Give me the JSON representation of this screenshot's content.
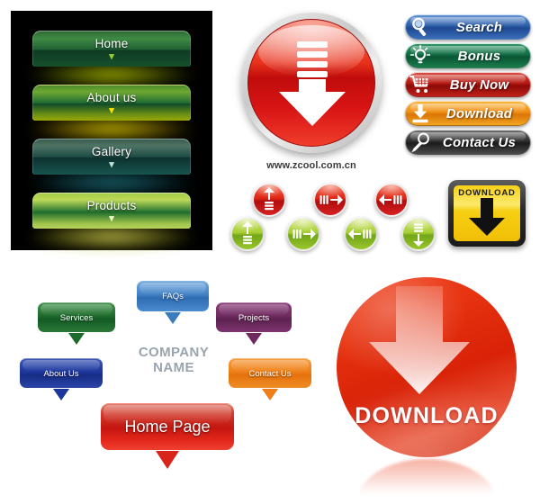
{
  "dark_nav": {
    "items": [
      {
        "label": "Home",
        "chevron": "chevron-down",
        "accent": "#c8d900"
      },
      {
        "label": "About us",
        "chevron": "chevron-down",
        "accent": "#f2e100"
      },
      {
        "label": "Gallery",
        "chevron": "chevron-down",
        "accent": "#1f7a86"
      },
      {
        "label": "Products",
        "chevron": "chevron-down",
        "accent": "#e8e45c"
      }
    ]
  },
  "red_circle_button": {
    "icon": "download-arrow-icon",
    "accent": "#d81414"
  },
  "watermark": {
    "url_text": "www.zcool.com.cn"
  },
  "arrow_buttons": {
    "red_row": [
      {
        "direction": "up",
        "icon": "arrow-up-icon",
        "color": "#d82121"
      },
      {
        "direction": "right",
        "icon": "arrow-right-icon",
        "color": "#d82121"
      },
      {
        "direction": "left",
        "icon": "arrow-left-icon",
        "color": "#d82121"
      }
    ],
    "green_row": [
      {
        "direction": "up",
        "icon": "arrow-up-icon",
        "color": "#9ac62b"
      },
      {
        "direction": "right",
        "icon": "arrow-right-icon",
        "color": "#9ac62b"
      },
      {
        "direction": "left",
        "icon": "arrow-left-icon",
        "color": "#9ac62b"
      },
      {
        "direction": "down",
        "icon": "arrow-down-icon",
        "color": "#9ac62b"
      }
    ]
  },
  "yellow_download_button": {
    "label": "DOWNLOAD",
    "icon": "arrow-down-icon",
    "accent": "#f6cf12"
  },
  "pill_buttons": [
    {
      "label": "Search",
      "icon": "magnifier-icon",
      "color": "#2c5da8"
    },
    {
      "label": "Bonus",
      "icon": "lightbulb-icon",
      "color": "#0f6b42"
    },
    {
      "label": "Buy Now",
      "icon": "shopping-cart-icon",
      "color": "#b4170f"
    },
    {
      "label": "Download",
      "icon": "download-tray-icon",
      "color": "#ef8c10"
    },
    {
      "label": "Contact Us",
      "icon": "pen-icon",
      "color": "#2f2f2f"
    }
  ],
  "bubble_nav": {
    "company_name_line1": "COMPANY",
    "company_name_line2": "NAME",
    "items": [
      {
        "label": "FAQs",
        "color": "#3f7fc4",
        "glow": "#63b4f2"
      },
      {
        "label": "Services",
        "color": "#1d6b2c",
        "glow": "#6fd06a"
      },
      {
        "label": "Projects",
        "color": "#6e2a5e",
        "glow": "#e255c8"
      },
      {
        "label": "About Us",
        "color": "#1d369b",
        "glow": "#49b7f5"
      },
      {
        "label": "Contact Us",
        "color": "#ee7f18",
        "glow": "#ffd400"
      },
      {
        "label": "Home Page",
        "color": "#c4160f",
        "glow": "#ff4b2a"
      }
    ]
  },
  "big_download_button": {
    "label": "DOWNLOAD",
    "icon": "arrow-down-icon",
    "accent": "#e5310f"
  }
}
